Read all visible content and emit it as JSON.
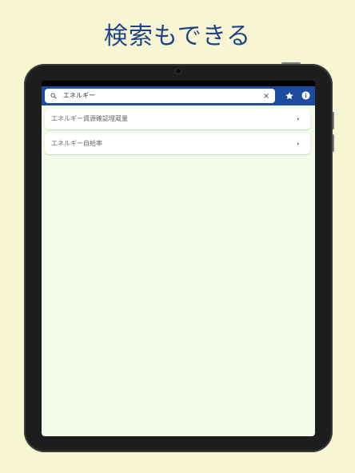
{
  "headline": "検索もできる",
  "search": {
    "query": "エネルギー"
  },
  "icons": {
    "search": "search-icon",
    "clear": "close-icon",
    "favorites": "star-icon",
    "info": "info-icon",
    "row_chevron": "chevron-right-icon"
  },
  "colors": {
    "background": "#f8f6d2",
    "headline": "#1f4488",
    "appbar": "#1e4b9f",
    "content": "#f2fbea"
  },
  "results": [
    {
      "label": "エネルギー資源確認埋蔵量"
    },
    {
      "label": "エネルギー自給率"
    }
  ]
}
